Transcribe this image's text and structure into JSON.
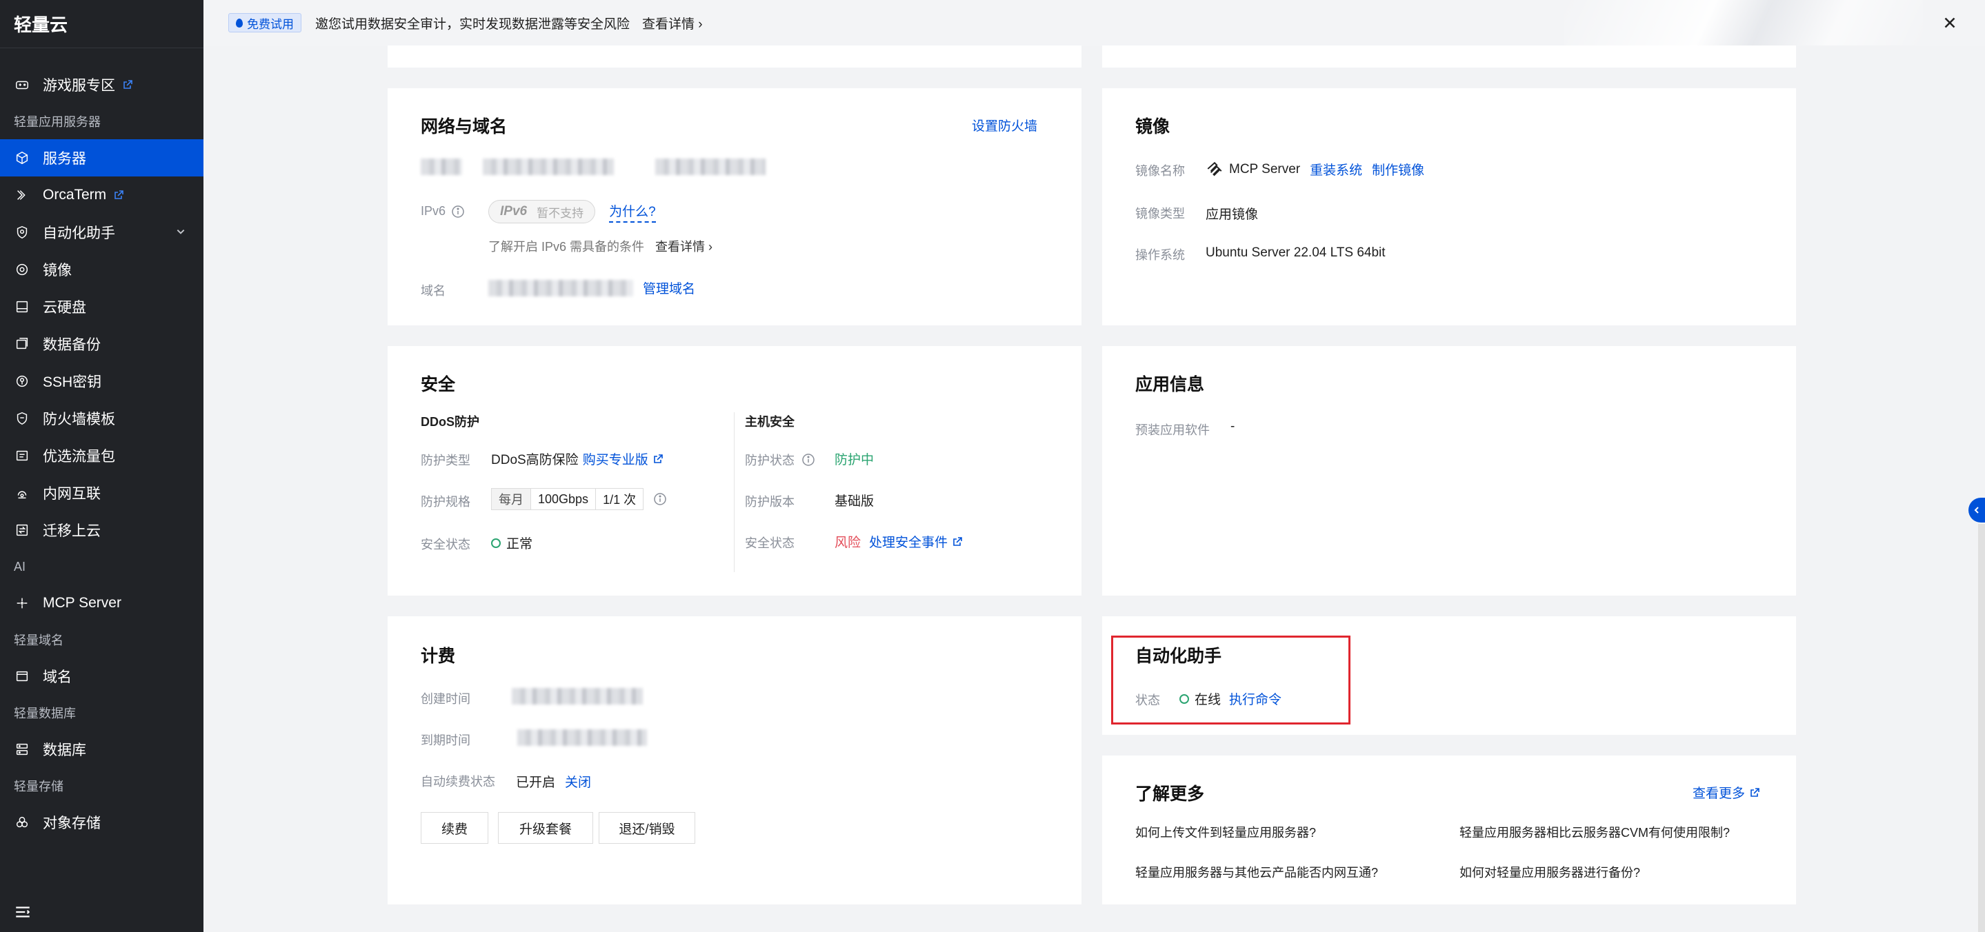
{
  "sidebar": {
    "brand": "轻量云",
    "items": [
      {
        "type": "item",
        "label": "游戏服专区",
        "icon": "gamepad-icon",
        "external": true
      },
      {
        "type": "group",
        "label": "轻量应用服务器"
      },
      {
        "type": "item",
        "label": "服务器",
        "icon": "cube-icon",
        "active": true
      },
      {
        "type": "item",
        "label": "OrcaTerm",
        "icon": "terminal-icon",
        "external": true
      },
      {
        "type": "item",
        "label": "自动化助手",
        "icon": "automation-icon",
        "expandable": true
      },
      {
        "type": "item",
        "label": "镜像",
        "icon": "disc-icon"
      },
      {
        "type": "item",
        "label": "云硬盘",
        "icon": "disk-icon"
      },
      {
        "type": "item",
        "label": "数据备份",
        "icon": "backup-icon"
      },
      {
        "type": "item",
        "label": "SSH密钥",
        "icon": "key-icon"
      },
      {
        "type": "item",
        "label": "防火墙模板",
        "icon": "shield-icon"
      },
      {
        "type": "item",
        "label": "优选流量包",
        "icon": "traffic-icon"
      },
      {
        "type": "item",
        "label": "内网互联",
        "icon": "network-icon"
      },
      {
        "type": "item",
        "label": "迁移上云",
        "icon": "migrate-icon"
      },
      {
        "type": "group",
        "label": "AI"
      },
      {
        "type": "item",
        "label": "MCP Server",
        "icon": "sparkle-icon"
      },
      {
        "type": "group",
        "label": "轻量域名"
      },
      {
        "type": "item",
        "label": "域名",
        "icon": "domain-icon"
      },
      {
        "type": "group",
        "label": "轻量数据库"
      },
      {
        "type": "item",
        "label": "数据库",
        "icon": "database-icon"
      },
      {
        "type": "group",
        "label": "轻量存储"
      },
      {
        "type": "item",
        "label": "对象存储",
        "icon": "storage-icon"
      }
    ]
  },
  "banner": {
    "badge": "免费试用",
    "text": "邀您试用数据安全审计，实时发现数据泄露等安全风险",
    "link": "查看详情"
  },
  "network": {
    "title": "网络与域名",
    "firewall_link": "设置防火墙",
    "ipv6_label": "IPv6",
    "ipv6_pill_brand": "IPv6",
    "ipv6_pill_status": "暂不支持",
    "ipv6_why": "为什么?",
    "ipv6_hint": "了解开启 IPv6 需具备的条件",
    "ipv6_hint_link": "查看详情",
    "domain_label": "域名",
    "domain_link": "管理域名"
  },
  "image": {
    "title": "镜像",
    "name_label": "镜像名称",
    "name_value": "MCP Server",
    "reinstall_link": "重装系统",
    "make_link": "制作镜像",
    "type_label": "镜像类型",
    "type_value": "应用镜像",
    "os_label": "操作系统",
    "os_value": "Ubuntu Server 22.04 LTS 64bit"
  },
  "security": {
    "title": "安全",
    "ddos_title": "DDoS防护",
    "type_label": "防护类型",
    "type_value": "DDoS高防保险",
    "buy_link": "购买专业版",
    "spec_label": "防护规格",
    "spec_period": "每月",
    "spec_bandwidth": "100Gbps",
    "spec_count": "1/1 次",
    "status_label": "安全状态",
    "status_value": "正常",
    "host_title": "主机安全",
    "host_status_label": "防护状态",
    "host_status_value": "防护中",
    "host_version_label": "防护版本",
    "host_version_value": "基础版",
    "host_safety_label": "安全状态",
    "host_safety_value": "风险",
    "host_handle_link": "处理安全事件"
  },
  "app_info": {
    "title": "应用信息",
    "preinstalled_label": "预装应用软件",
    "preinstalled_value": "-"
  },
  "billing": {
    "title": "计费",
    "created_label": "创建时间",
    "expire_label": "到期时间",
    "autorenew_label": "自动续费状态",
    "autorenew_value": "已开启",
    "autorenew_link": "关闭",
    "btn_renew": "续费",
    "btn_upgrade": "升级套餐",
    "btn_refund": "退还/销毁"
  },
  "automation": {
    "title": "自动化助手",
    "status_label": "状态",
    "status_value": "在线",
    "exec_link": "执行命令"
  },
  "learn_more": {
    "title": "了解更多",
    "more_link": "查看更多",
    "q1": "如何上传文件到轻量应用服务器?",
    "q2": "轻量应用服务器相比云服务器CVM有何使用限制?",
    "q3": "轻量应用服务器与其他云产品能否内网互通?",
    "q4": "如何对轻量应用服务器进行备份?"
  },
  "colors": {
    "sidebar_bg": "#212327",
    "active": "#0052d9",
    "link": "#0052d9",
    "ok": "#2ba471",
    "risk": "#e34d59",
    "highlight": "#e0262f"
  }
}
